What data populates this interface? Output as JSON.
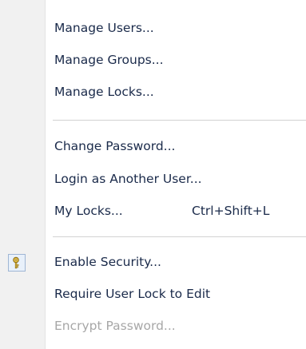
{
  "menu": {
    "items": [
      {
        "label": "Manage Users..."
      },
      {
        "label": "Manage Groups..."
      },
      {
        "label": "Manage Locks..."
      },
      {
        "label": "Change Password..."
      },
      {
        "label": "Login as Another User..."
      },
      {
        "label": "My Locks...",
        "shortcut": "Ctrl+Shift+L"
      },
      {
        "label": "Enable Security...",
        "icon": "key-icon",
        "checked": true
      },
      {
        "label": "Require User Lock to Edit"
      },
      {
        "label": "Encrypt Password...",
        "disabled": true
      }
    ]
  },
  "colors": {
    "text": "#1a2a4a",
    "disabled_text": "#a7a7a7",
    "gutter": "#f1f1f1",
    "check_frame_border": "#9fb6d4",
    "check_frame_fill": "#e8f0fa",
    "key_icon": "#c9a227"
  }
}
